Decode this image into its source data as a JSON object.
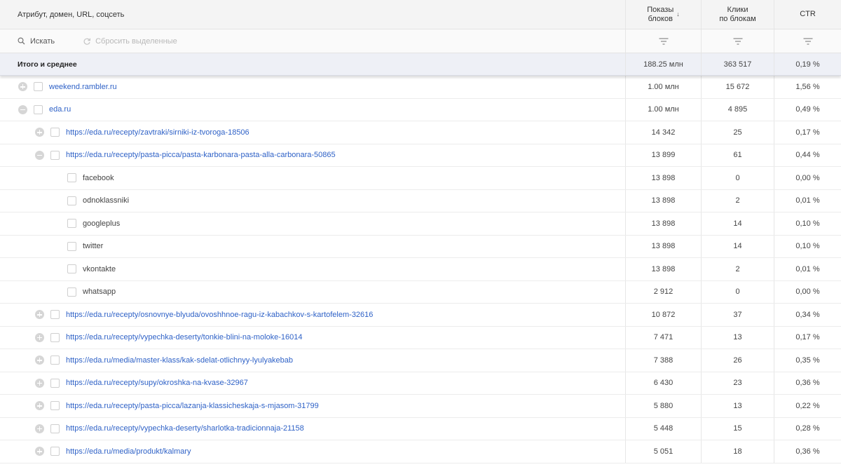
{
  "header": {
    "name_col": "Атрибут, домен, URL, соцсеть",
    "shows_col": [
      "Показы",
      "блоков"
    ],
    "clicks_col": [
      "Клики",
      "по блокам"
    ],
    "ctr_col": "CTR"
  },
  "toolbar": {
    "search_label": "Искать",
    "reset_label": "Сбросить выделенные"
  },
  "totals": {
    "label": "Итого и среднее",
    "shows": "188.25 млн",
    "clicks": "363 517",
    "ctr": "0,19 %"
  },
  "rows": [
    {
      "level": 0,
      "expander": "plus",
      "link": true,
      "label": "weekend.rambler.ru",
      "shows": "1.00 млн",
      "clicks": "15 672",
      "ctr": "1,56 %"
    },
    {
      "level": 0,
      "expander": "minus",
      "link": true,
      "label": "eda.ru",
      "shows": "1.00 млн",
      "clicks": "4 895",
      "ctr": "0,49 %"
    },
    {
      "level": 1,
      "expander": "plus",
      "link": true,
      "label": "https://eda.ru/recepty/zavtraki/sirniki-iz-tvoroga-18506",
      "shows": "14 342",
      "clicks": "25",
      "ctr": "0,17 %"
    },
    {
      "level": 1,
      "expander": "minus",
      "link": true,
      "label": "https://eda.ru/recepty/pasta-picca/pasta-karbonara-pasta-alla-carbonara-50865",
      "shows": "13 899",
      "clicks": "61",
      "ctr": "0,44 %"
    },
    {
      "level": 2,
      "expander": "none",
      "link": false,
      "label": "facebook",
      "shows": "13 898",
      "clicks": "0",
      "ctr": "0,00 %"
    },
    {
      "level": 2,
      "expander": "none",
      "link": false,
      "label": "odnoklassniki",
      "shows": "13 898",
      "clicks": "2",
      "ctr": "0,01 %"
    },
    {
      "level": 2,
      "expander": "none",
      "link": false,
      "label": "googleplus",
      "shows": "13 898",
      "clicks": "14",
      "ctr": "0,10 %"
    },
    {
      "level": 2,
      "expander": "none",
      "link": false,
      "label": "twitter",
      "shows": "13 898",
      "clicks": "14",
      "ctr": "0,10 %"
    },
    {
      "level": 2,
      "expander": "none",
      "link": false,
      "label": "vkontakte",
      "shows": "13 898",
      "clicks": "2",
      "ctr": "0,01 %"
    },
    {
      "level": 2,
      "expander": "none",
      "link": false,
      "label": "whatsapp",
      "shows": "2 912",
      "clicks": "0",
      "ctr": "0,00 %"
    },
    {
      "level": 1,
      "expander": "plus",
      "link": true,
      "label": "https://eda.ru/recepty/osnovnye-blyuda/ovoshhnoe-ragu-iz-kabachkov-s-kartofelem-32616",
      "shows": "10 872",
      "clicks": "37",
      "ctr": "0,34 %"
    },
    {
      "level": 1,
      "expander": "plus",
      "link": true,
      "label": "https://eda.ru/recepty/vypechka-deserty/tonkie-blini-na-moloke-16014",
      "shows": "7 471",
      "clicks": "13",
      "ctr": "0,17 %"
    },
    {
      "level": 1,
      "expander": "plus",
      "link": true,
      "label": "https://eda.ru/media/master-klass/kak-sdelat-otlichnyy-lyulyakebab",
      "shows": "7 388",
      "clicks": "26",
      "ctr": "0,35 %"
    },
    {
      "level": 1,
      "expander": "plus",
      "link": true,
      "label": "https://eda.ru/recepty/supy/okroshka-na-kvase-32967",
      "shows": "6 430",
      "clicks": "23",
      "ctr": "0,36 %"
    },
    {
      "level": 1,
      "expander": "plus",
      "link": true,
      "label": "https://eda.ru/recepty/pasta-picca/lazanja-klassicheskaja-s-mjasom-31799",
      "shows": "5 880",
      "clicks": "13",
      "ctr": "0,22 %"
    },
    {
      "level": 1,
      "expander": "plus",
      "link": true,
      "label": "https://eda.ru/recepty/vypechka-deserty/sharlotka-tradicionnaja-21158",
      "shows": "5 448",
      "clicks": "15",
      "ctr": "0,28 %"
    },
    {
      "level": 1,
      "expander": "plus",
      "link": true,
      "label": "https://eda.ru/media/produkt/kalmary",
      "shows": "5 051",
      "clicks": "18",
      "ctr": "0,36 %"
    }
  ]
}
